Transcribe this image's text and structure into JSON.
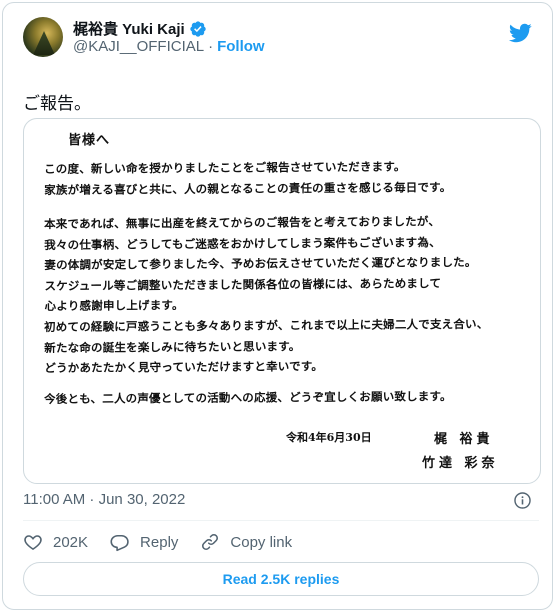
{
  "author": {
    "name": "梶裕貴 Yuki Kaji",
    "handle": "@KAJI__OFFICIAL",
    "separator": "·",
    "follow_label": "Follow",
    "verified": true
  },
  "tweet": {
    "text": "ご報告。",
    "timestamp": "11:00 AM · Jun 30, 2022"
  },
  "letter": {
    "greeting": "皆様へ",
    "paragraphs": [
      [
        "この度、新しい命を授かりましたことをご報告させていただきます。",
        "家族が増える喜びと共に、人の親となることの責任の重さを感じる毎日です。"
      ],
      [
        "本来であれば、無事に出産を終えてからのご報告をと考えておりましたが、",
        "我々の仕事柄、どうしてもご迷惑をおかけしてしまう案件もございます為、",
        "妻の体調が安定して参りました今、予めお伝えさせていただく運びとなりました。",
        "スケジュール等ご調整いただきました関係各位の皆様には、あらためまして",
        "心より感謝申し上げます。"
      ],
      [
        "初めての経験に戸惑うことも多々ありますが、これまで以上に夫婦二人で支え合い、",
        "新たな命の誕生を楽しみに待ちたいと思います。",
        "どうかあたたかく見守っていただけますと幸いです。"
      ],
      [
        "今後とも、二人の声優としての活動への応援、どうぞ宜しくお願い致します。"
      ]
    ],
    "date": "令和4年6月30日",
    "signature_1": "梶 裕貴",
    "signature_2": "竹達 彩奈"
  },
  "actions": {
    "likes": "202K",
    "reply_label": "Reply",
    "copy_link_label": "Copy link"
  },
  "read_replies_label": "Read 2.5K replies",
  "colors": {
    "accent": "#1d9bf0",
    "secondary_text": "#536471",
    "border": "#cfd9de"
  }
}
